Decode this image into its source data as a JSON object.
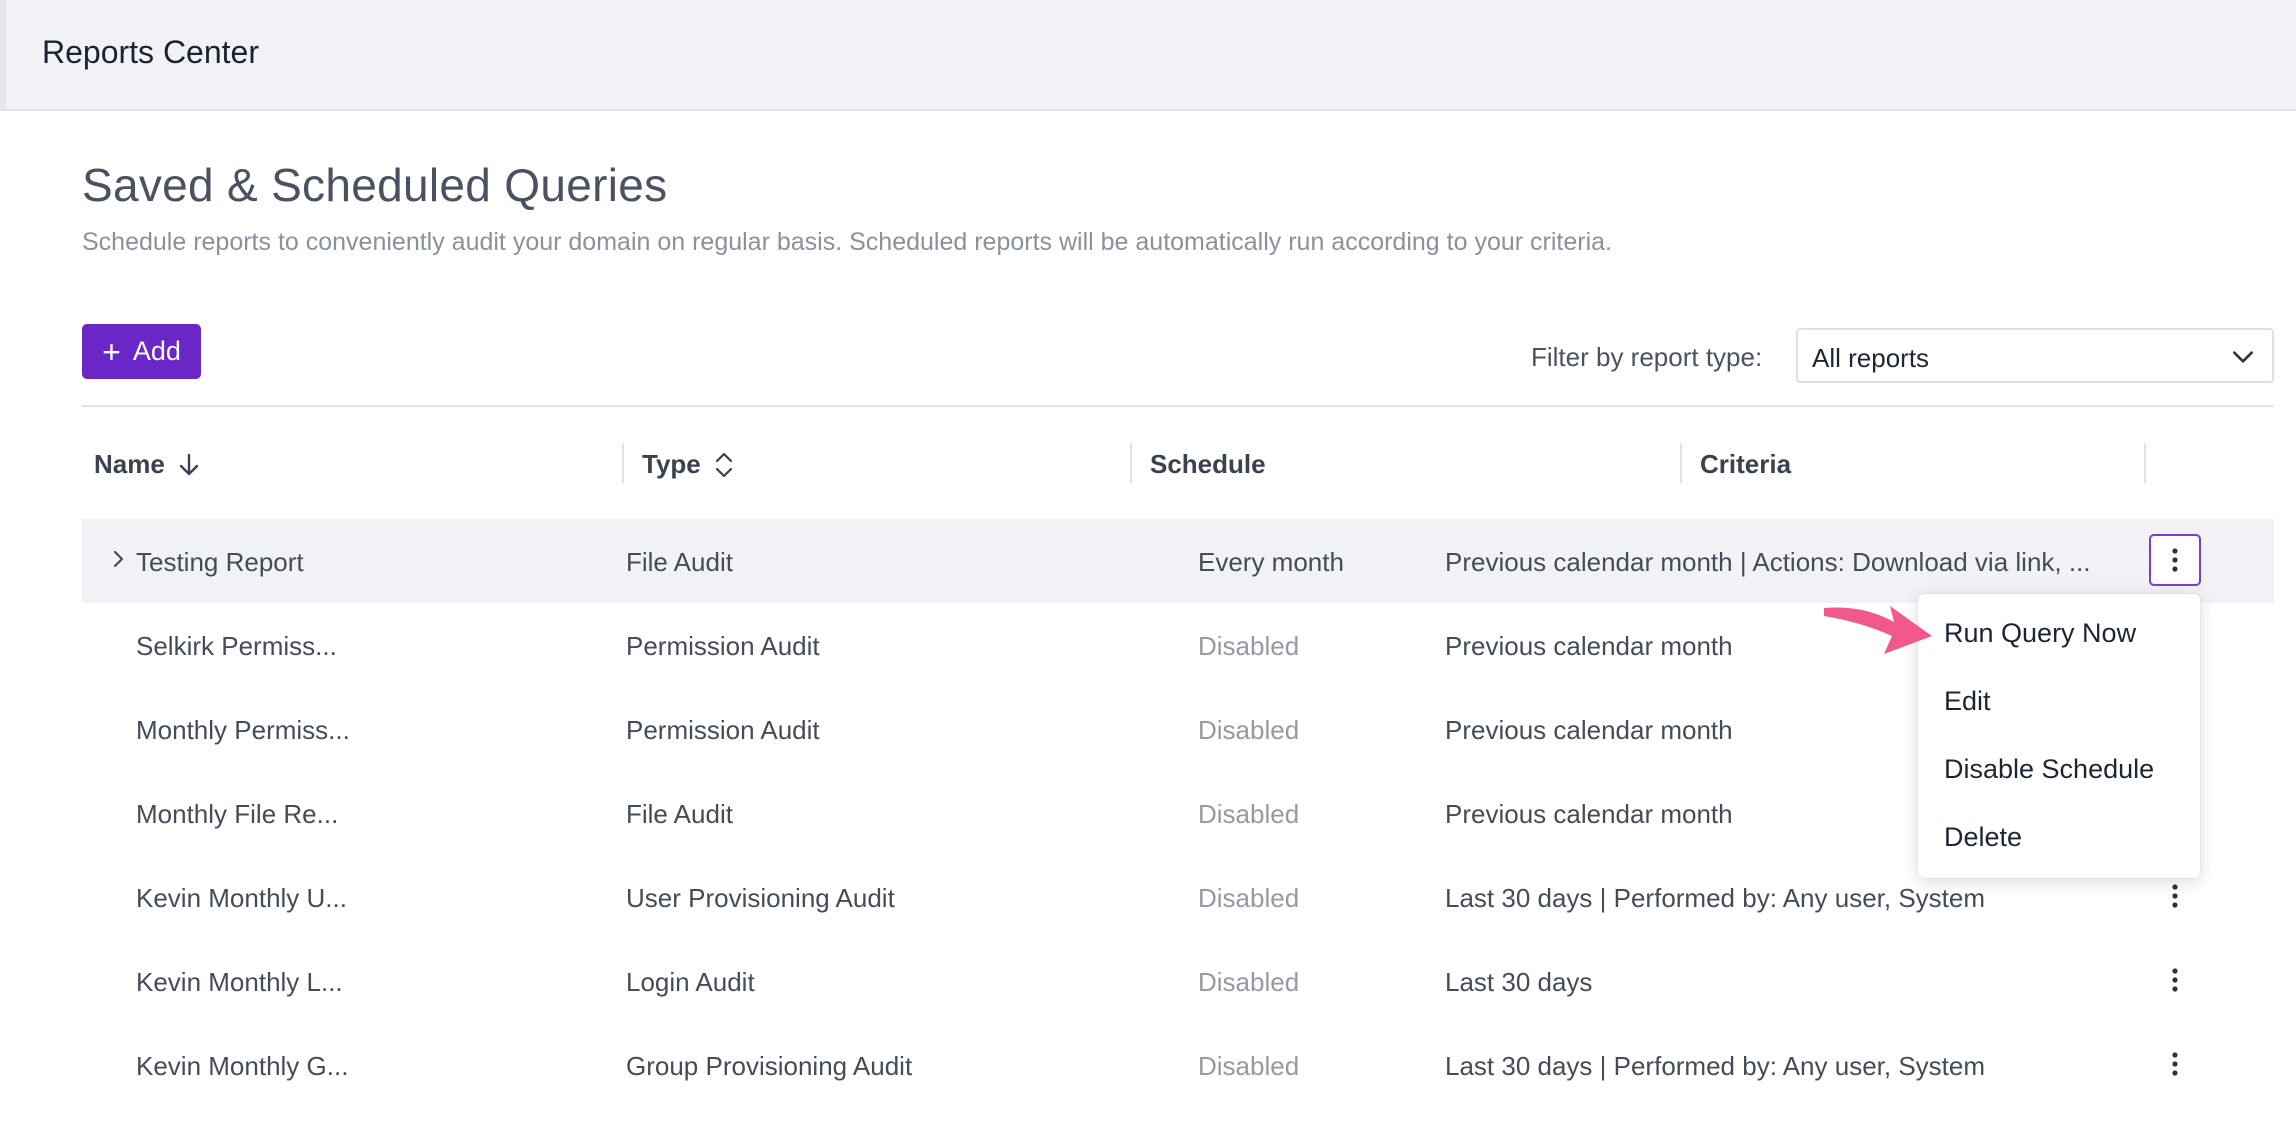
{
  "header": {
    "title": "Reports Center"
  },
  "page": {
    "title": "Saved & Scheduled Queries",
    "description": "Schedule reports to conveniently audit your domain on regular basis. Scheduled reports will be automatically run according to your criteria."
  },
  "toolbar": {
    "add_label": "Add",
    "filter_label": "Filter by report type:",
    "filter_value": "All reports"
  },
  "table": {
    "columns": {
      "name": "Name",
      "type": "Type",
      "schedule": "Schedule",
      "criteria": "Criteria"
    },
    "rows": [
      {
        "name": "Testing Report",
        "type": "File Audit",
        "schedule": "Every month",
        "criteria": "Previous calendar month | Actions: Download via link, ..."
      },
      {
        "name": "Selkirk Permiss...",
        "type": "Permission Audit",
        "schedule": "Disabled",
        "criteria": "Previous calendar month"
      },
      {
        "name": "Monthly Permiss...",
        "type": "Permission Audit",
        "schedule": "Disabled",
        "criteria": "Previous calendar month"
      },
      {
        "name": "Monthly File Re...",
        "type": "File Audit",
        "schedule": "Disabled",
        "criteria": "Previous calendar month"
      },
      {
        "name": "Kevin Monthly U...",
        "type": "User Provisioning Audit",
        "schedule": "Disabled",
        "criteria": "Last 30 days | Performed by: Any user, System"
      },
      {
        "name": "Kevin Monthly L...",
        "type": "Login Audit",
        "schedule": "Disabled",
        "criteria": "Last 30 days"
      },
      {
        "name": "Kevin Monthly G...",
        "type": "Group Provisioning Audit",
        "schedule": "Disabled",
        "criteria": "Last 30 days | Performed by: Any user, System"
      }
    ]
  },
  "context_menu": {
    "items": [
      "Run Query Now",
      "Edit",
      "Disable Schedule",
      "Delete"
    ]
  },
  "colors": {
    "accent": "#6b26c8",
    "arrow": "#f0598a"
  }
}
